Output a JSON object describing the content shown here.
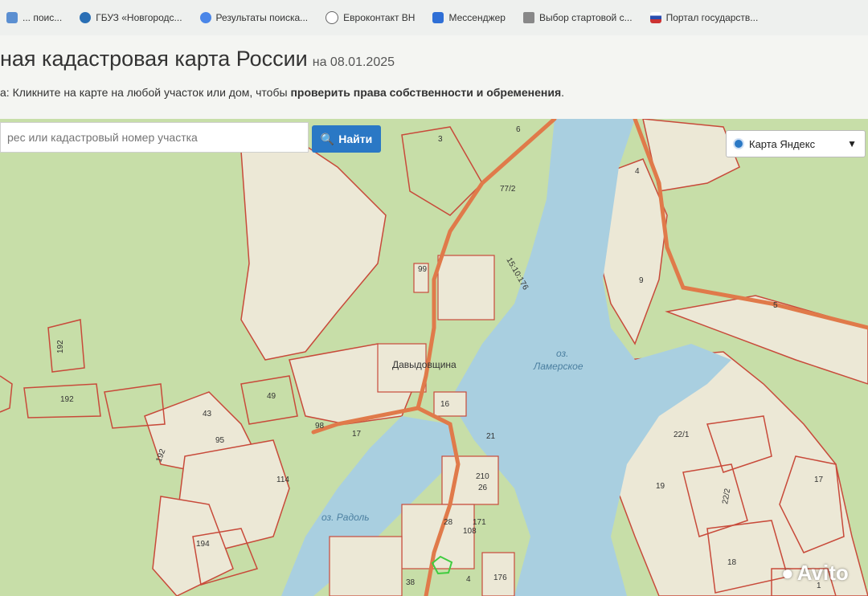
{
  "bookmarks": [
    {
      "label": "... поис...",
      "icon": "page-icon"
    },
    {
      "label": "ГБУЗ «Новгородс...",
      "icon": "heart-icon"
    },
    {
      "label": "Результаты поиска...",
      "icon": "google-icon"
    },
    {
      "label": "Евроконтакт ВН",
      "icon": "globe-icon"
    },
    {
      "label": "Мессенджер",
      "icon": "messenger-icon"
    },
    {
      "label": "Выбор стартовой с...",
      "icon": "pin-icon"
    },
    {
      "label": "Портал государств...",
      "icon": "flag-icon"
    }
  ],
  "header": {
    "title": "ная кадастровая карта России",
    "date": "на 08.01.2025",
    "hint_prefix": "а: Кликните на карте на любой участок или дом, чтобы ",
    "hint_bold": "проверить права собственности и обременения",
    "hint_suffix": "."
  },
  "search": {
    "placeholder": "рес или кадастровый номер участка",
    "button_label": "Найти"
  },
  "layer": {
    "selected": "Карта Яндекс"
  },
  "map": {
    "village": "Давыдовщина",
    "lake_lamerskoe_line1": "оз.",
    "lake_lamerskoe_line2": "Ламерское",
    "lake_radol": "оз. Радоль",
    "parcels": [
      "3",
      "6",
      "77/2",
      "99",
      "15:10:176",
      "4",
      "9",
      "5",
      "192",
      "192",
      "192",
      "49",
      "43",
      "95",
      "114",
      "194",
      "98",
      "17",
      "16",
      "21",
      "210",
      "26",
      "171",
      "108",
      "28",
      "38",
      "176",
      "4",
      "22/1",
      "19",
      "22/2",
      "17",
      "18",
      "1"
    ]
  },
  "watermark": "Avito",
  "colors": {
    "forest": "#c7dea8",
    "field": "#ece8d6",
    "water": "#a9cfe0",
    "border": "#c84a3a",
    "road": "#e07a4a",
    "button": "#2a78c5"
  }
}
